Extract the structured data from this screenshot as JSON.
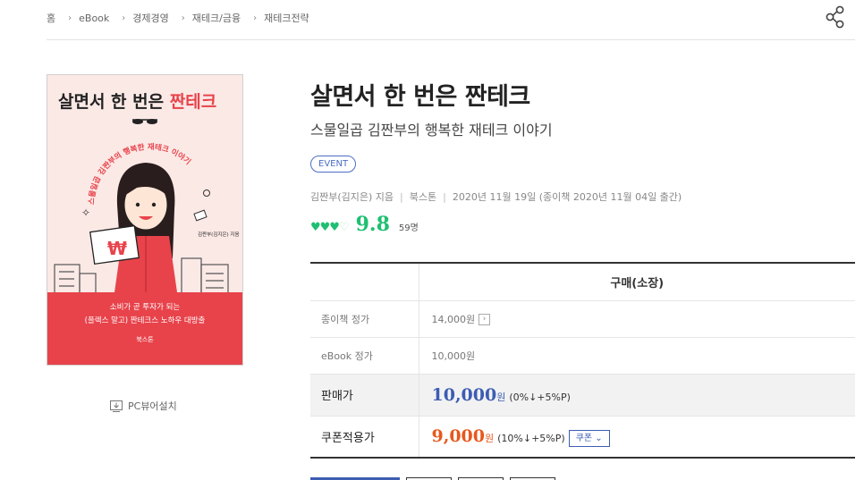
{
  "breadcrumb": [
    "홈",
    "eBook",
    "경제경영",
    "재테크/금융",
    "재테크전략"
  ],
  "book": {
    "title": "살면서 한 번은 짠테크",
    "subtitle": "스물일곱 김짠부의 행복한 재테크 이야기",
    "event_badge": "EVENT",
    "author": "김짠부(김지은) 지음",
    "publisher": "북스톤",
    "date": "2020년 11월 19일 (종이책 2020년 11월 04일 출간)",
    "rating": "9.8",
    "rating_hearts": 4,
    "review_count": "59명"
  },
  "cover": {
    "title_black": "살면서 한 번은",
    "title_red": "짠테크",
    "arc_text": "스물일곱 김짠부의 행복한 재테크 이야기",
    "author_small": "김짠부(김지은) 지음",
    "bottom_line1": "소비가 곧 투자가 되는",
    "bottom_line2": "(플렉스 말고) 짠테크스 노하우 대방출",
    "publisher": "북스톤",
    "won_symbol": "₩",
    "colors": {
      "bg": "#fbe9e6",
      "red": "#e8434b",
      "dark": "#222222"
    }
  },
  "pc_viewer": "PC뷰어설치",
  "price_table": {
    "header": "구매(소장)",
    "paper_label": "종이책 정가",
    "paper_price": "14,000원",
    "ebook_label": "eBook 정가",
    "ebook_price": "10,000원",
    "sale_label": "판매가",
    "sale_price": "10,000",
    "sale_unit": "원",
    "sale_rate": "(0%↓+5%P)",
    "coupon_label": "쿠폰적용가",
    "coupon_price": "9,000",
    "coupon_unit": "원",
    "coupon_rate": "(10%↓+5%P)",
    "coupon_button": "쿠폰 ⌄"
  },
  "colors": {
    "accent_blue": "#3d5db3",
    "price_red": "#e8571c",
    "heart_green": "#1fbf72"
  }
}
